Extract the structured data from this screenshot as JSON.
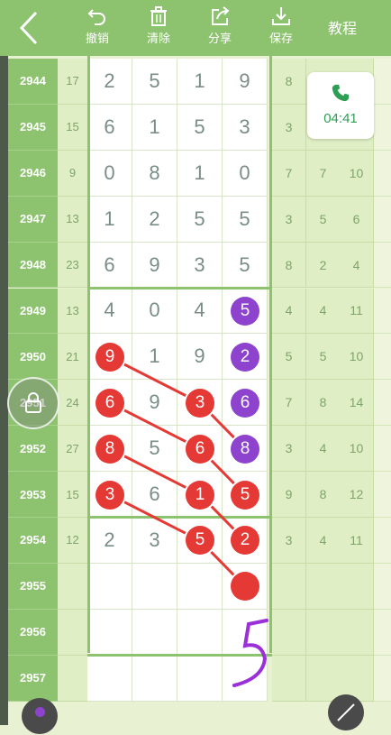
{
  "toolbar": {
    "undo_label": "撤销",
    "clear_label": "清除",
    "share_label": "分享",
    "save_label": "保存",
    "tutorial_label": "教程"
  },
  "call_widget": {
    "duration": "04:41"
  },
  "rows": [
    {
      "issue": "2944",
      "sum": "17",
      "digits": [
        "2",
        "5",
        "1",
        "9"
      ],
      "right": [
        "8",
        "",
        ""
      ]
    },
    {
      "issue": "2945",
      "sum": "15",
      "digits": [
        "6",
        "1",
        "5",
        "3"
      ],
      "right": [
        "3",
        "",
        ""
      ]
    },
    {
      "issue": "2946",
      "sum": "9",
      "digits": [
        "0",
        "8",
        "1",
        "0"
      ],
      "right": [
        "7",
        "7",
        "10"
      ]
    },
    {
      "issue": "2947",
      "sum": "13",
      "digits": [
        "1",
        "2",
        "5",
        "5"
      ],
      "right": [
        "3",
        "5",
        "6"
      ]
    },
    {
      "issue": "2948",
      "sum": "23",
      "digits": [
        "6",
        "9",
        "3",
        "5"
      ],
      "right": [
        "8",
        "2",
        "4"
      ]
    },
    {
      "issue": "2949",
      "sum": "13",
      "digits": [
        "4",
        "0",
        "4",
        "5"
      ],
      "right": [
        "4",
        "4",
        "11"
      ]
    },
    {
      "issue": "2950",
      "sum": "21",
      "digits": [
        "9",
        "1",
        "9",
        "2"
      ],
      "right": [
        "5",
        "5",
        "10"
      ]
    },
    {
      "issue": "2951",
      "sum": "24",
      "digits": [
        "6",
        "9",
        "3",
        "6"
      ],
      "right": [
        "7",
        "8",
        "14"
      ]
    },
    {
      "issue": "2952",
      "sum": "27",
      "digits": [
        "8",
        "5",
        "6",
        "8"
      ],
      "right": [
        "3",
        "4",
        "10"
      ]
    },
    {
      "issue": "2953",
      "sum": "15",
      "digits": [
        "3",
        "6",
        "1",
        "5"
      ],
      "right": [
        "9",
        "8",
        "12"
      ]
    },
    {
      "issue": "2954",
      "sum": "12",
      "digits": [
        "2",
        "3",
        "5",
        "2"
      ],
      "right": [
        "3",
        "4",
        "11"
      ]
    },
    {
      "issue": "2955",
      "sum": "",
      "digits": [
        "",
        "",
        "",
        ""
      ],
      "right": [
        "",
        "",
        ""
      ]
    },
    {
      "issue": "2956",
      "sum": "",
      "digits": [
        "",
        "",
        "",
        ""
      ],
      "right": [
        "",
        "",
        ""
      ]
    },
    {
      "issue": "2957",
      "sum": "",
      "digits": [
        "",
        "",
        "",
        ""
      ],
      "right": [
        "",
        "",
        ""
      ]
    }
  ],
  "highlighted": [
    {
      "row": 5,
      "col": 3,
      "value": "5",
      "color": "#8e43cf"
    },
    {
      "row": 6,
      "col": 0,
      "value": "9",
      "color": "#e53935"
    },
    {
      "row": 6,
      "col": 3,
      "value": "2",
      "color": "#8e43cf"
    },
    {
      "row": 7,
      "col": 0,
      "value": "6",
      "color": "#e53935"
    },
    {
      "row": 7,
      "col": 2,
      "value": "3",
      "color": "#e53935"
    },
    {
      "row": 7,
      "col": 3,
      "value": "6",
      "color": "#8e43cf"
    },
    {
      "row": 8,
      "col": 0,
      "value": "8",
      "color": "#e53935"
    },
    {
      "row": 8,
      "col": 2,
      "value": "6",
      "color": "#e53935"
    },
    {
      "row": 8,
      "col": 3,
      "value": "8",
      "color": "#8e43cf"
    },
    {
      "row": 9,
      "col": 0,
      "value": "3",
      "color": "#e53935"
    },
    {
      "row": 9,
      "col": 2,
      "value": "1",
      "color": "#e53935"
    },
    {
      "row": 9,
      "col": 3,
      "value": "5",
      "color": "#e53935"
    },
    {
      "row": 10,
      "col": 2,
      "value": "5",
      "color": "#e53935"
    },
    {
      "row": 10,
      "col": 3,
      "value": "2",
      "color": "#e53935"
    },
    {
      "row": 11,
      "col": 3,
      "value": "",
      "color": "#e53935"
    }
  ],
  "connections": [
    [
      [
        6,
        0
      ],
      [
        7,
        2
      ],
      [
        8,
        3
      ]
    ],
    [
      [
        7,
        0
      ],
      [
        8,
        2
      ],
      [
        9,
        3
      ]
    ],
    [
      [
        8,
        0
      ],
      [
        9,
        2
      ],
      [
        10,
        3
      ]
    ],
    [
      [
        9,
        0
      ],
      [
        10,
        2
      ],
      [
        11,
        3
      ]
    ]
  ],
  "handwriting": {
    "text": "5",
    "color": "#9b30d9"
  },
  "colors": {
    "accent": "#8dc26f",
    "ball_red": "#e53935",
    "ball_purple": "#8e43cf"
  }
}
